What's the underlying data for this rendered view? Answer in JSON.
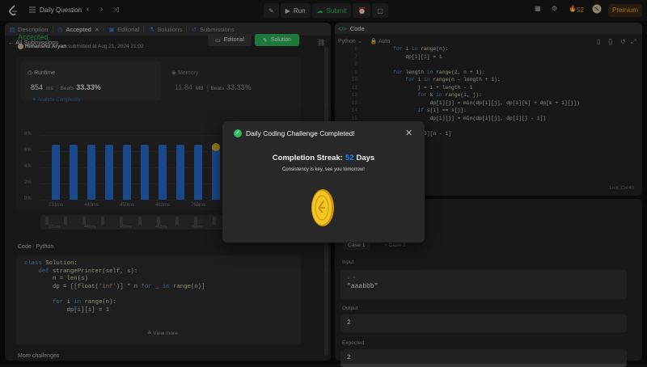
{
  "topbar": {
    "title": "Daily Question",
    "run_label": "Run",
    "submit_label": "Submit",
    "streak_count": "52",
    "premium_label": "Premium"
  },
  "left_tabs": [
    {
      "label": "Description"
    },
    {
      "label": "Accepted"
    },
    {
      "label": "Editorial"
    },
    {
      "label": "Solutions"
    },
    {
      "label": "Submissions"
    }
  ],
  "submission": {
    "back_label": "All Submissions",
    "status": "Accepted",
    "author": "Himanshu Aryan",
    "submitted_text": "submitted at Aug 21, 2024 21:02",
    "editorial_button": "Editorial",
    "solution_button": "Solution"
  },
  "stats": {
    "runtime_label": "Runtime",
    "runtime_value": "854",
    "runtime_unit": "ms",
    "runtime_beats_label": "Beats",
    "runtime_pct": "33.33%",
    "analyze_label": "Analyze Complexity",
    "memory_label": "Memory",
    "memory_value": "11.84",
    "memory_unit": "MB",
    "memory_beats_label": "Beats",
    "memory_pct": "33.33%"
  },
  "chart_data": {
    "type": "bar",
    "y_ticks": [
      "8%",
      "6%",
      "4%",
      "2%",
      "0%"
    ],
    "x_ticks": [
      "231ms",
      "440ms",
      "450ms",
      "463ms",
      "768ms"
    ],
    "minimap_ticks": [
      "231ms",
      "440ms",
      "450ms",
      "463ms",
      "768ms"
    ],
    "values": [
      6.8,
      6.8,
      6.8,
      6.8,
      6.8,
      6.8,
      6.8,
      6.8,
      6.8,
      6.8
    ],
    "ylim": [
      0,
      8
    ],
    "highlight_index": 9,
    "bar_color": "#2a6fd1"
  },
  "code_section": {
    "label_code": "Code",
    "label_lang": "Python",
    "view_more": "View more",
    "more_challenges": "More challenges"
  },
  "right_panel": {
    "code_title": "Code",
    "language": "Python",
    "auto_label": "Auto",
    "cursor_pos": "Ln 8, Col 40",
    "case_tabs": [
      "Case 1",
      "Case 2"
    ],
    "input_label": "Input",
    "input_var": "s =",
    "input_value": "\"aaabbb\"",
    "output_label": "Output",
    "output_value": "2",
    "expected_label": "Expected",
    "expected_value": "2"
  },
  "modal": {
    "title": "Daily Coding Challenge Completed!",
    "streak_prefix": "Completion Streak:",
    "streak_value": "52",
    "streak_suffix": "Days",
    "subtitle": "Consistency is key, see you tomorrow!"
  }
}
